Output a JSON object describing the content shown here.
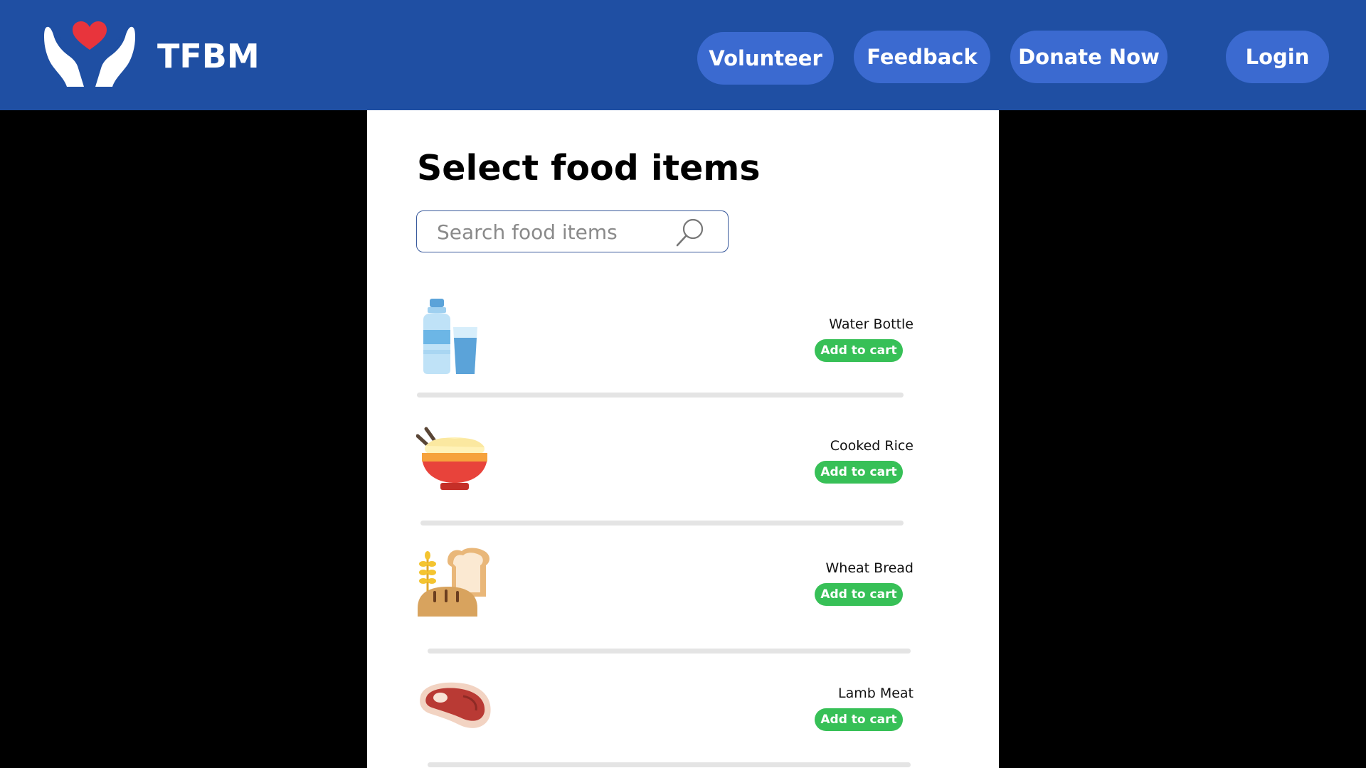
{
  "header": {
    "brand": "TFBM",
    "nav": {
      "volunteer": "Volunteer",
      "feedback": "Feedback",
      "donate": "Donate Now",
      "login": "Login"
    },
    "colors": {
      "bar": "#1f4fa3",
      "button": "#3b6ad0"
    }
  },
  "main": {
    "title": "Select food items",
    "search": {
      "placeholder": "Search food items",
      "value": ""
    },
    "items": [
      {
        "name": "Water Bottle",
        "button": "Add to cart",
        "icon": "water-bottle-icon"
      },
      {
        "name": "Cooked Rice",
        "button": "Add to cart",
        "icon": "rice-bowl-icon"
      },
      {
        "name": "Wheat Bread",
        "button": "Add to cart",
        "icon": "bread-icon"
      },
      {
        "name": "Lamb Meat",
        "button": "Add to cart",
        "icon": "steak-icon"
      }
    ],
    "colors": {
      "add_button": "#37c057"
    }
  }
}
